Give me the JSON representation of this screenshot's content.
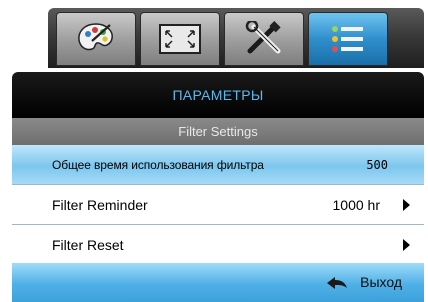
{
  "tabs": [
    {
      "icon": "palette-icon",
      "active": false
    },
    {
      "icon": "screen-resize-icon",
      "active": false
    },
    {
      "icon": "tools-icon",
      "active": false
    },
    {
      "icon": "options-list-icon",
      "active": true
    }
  ],
  "header": {
    "title": "ПАРАМЕТРЫ",
    "subtitle": "Filter Settings"
  },
  "rows": [
    {
      "label": "Общее время использования фильтра",
      "value": "500",
      "has_arrow": false
    },
    {
      "label": "Filter Reminder",
      "value": "1000 hr",
      "has_arrow": true
    },
    {
      "label": "Filter Reset",
      "value": "",
      "has_arrow": true
    }
  ],
  "footer": {
    "exit_label": "Выход",
    "exit_icon": "return-arrow-icon"
  },
  "colors": {
    "title_text": "#5fb8ea",
    "selected_row": "#7cc6ee",
    "active_tab": "#2f8fcc"
  }
}
